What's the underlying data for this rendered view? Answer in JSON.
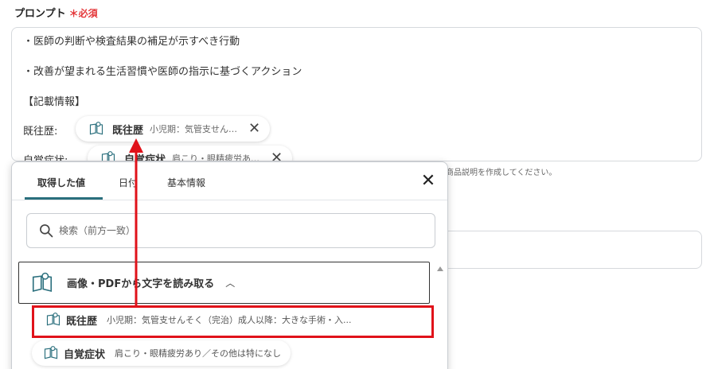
{
  "prompt": {
    "label": "プロンプト",
    "required_mark": "＊必須",
    "lines": [
      "・医師の判断や検査結果の補足が示すべき行動",
      "・改善が望まれる生活習慣や医師の指示に基づくアクション",
      "【記載情報】"
    ],
    "field_rows": [
      {
        "label": "既往歴:",
        "pill_name": "既往歴",
        "pill_value": "小児期：気管支せん…",
        "close": "✕"
      },
      {
        "label": "自覚症状:",
        "pill_name": "自覚症状",
        "pill_value": "肩こり・眼精疲労あ…",
        "close": "✕"
      }
    ]
  },
  "hint_text": "商品説明を作成してください。",
  "panel": {
    "tabs": [
      {
        "label": "取得した値",
        "active": true
      },
      {
        "label": "日付",
        "active": false
      },
      {
        "label": "基本情報",
        "active": false
      }
    ],
    "close": "✕",
    "search_placeholder": "検索（前方一致）",
    "group": {
      "title": "画像・PDFから文字を読み取る",
      "chevron": "︿"
    },
    "items": [
      {
        "name": "既往歴",
        "value": "小児期：気管支せんそく（完治）成人以降：大きな手術・入..."
      },
      {
        "name": "自覚症状",
        "value": "肩こり・眼精疲労あり／その他は特になし"
      }
    ]
  },
  "colors": {
    "accent_teal": "#2a6f7d",
    "highlight_red": "#e0121a",
    "required_red": "#e4373a"
  },
  "icons": [
    "book-icon",
    "close-icon",
    "search-icon",
    "chevron-up-icon",
    "scroll-up-icon"
  ]
}
